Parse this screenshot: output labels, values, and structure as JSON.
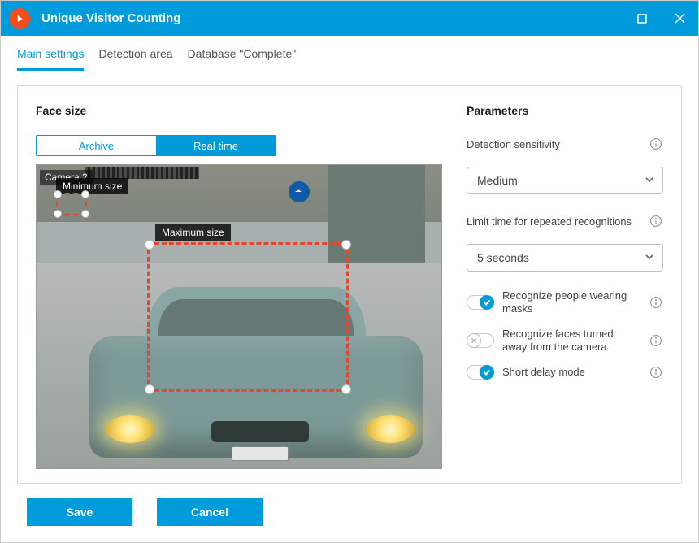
{
  "window": {
    "title": "Unique Visitor Counting"
  },
  "tabs": [
    {
      "label": "Main settings",
      "active": true
    },
    {
      "label": "Detection area",
      "active": false
    },
    {
      "label": "Database \"Complete\"",
      "active": false
    }
  ],
  "left": {
    "title": "Face size",
    "segmented": {
      "archive": "Archive",
      "realtime": "Real time",
      "selected": "realtime"
    },
    "camera_label": "Camera 2",
    "min_label": "Minimum size",
    "max_label": "Maximum size"
  },
  "right": {
    "title": "Parameters",
    "sensitivity_label": "Detection sensitivity",
    "sensitivity_value": "Medium",
    "limit_label": "Limit time for repeated recognitions",
    "limit_value": "5 seconds",
    "toggle_masks": "Recognize people wearing masks",
    "toggle_turned": "Recognize faces turned away from the camera",
    "toggle_short": "Short delay mode"
  },
  "footer": {
    "save": "Save",
    "cancel": "Cancel"
  }
}
